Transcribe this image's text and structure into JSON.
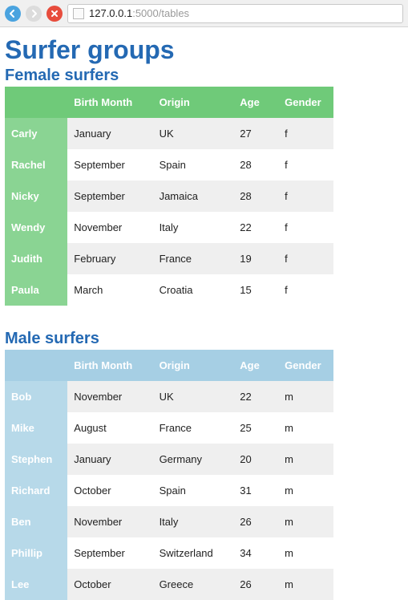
{
  "browser": {
    "url_host": "127.0.0.1",
    "url_path": ":5000/tables"
  },
  "page": {
    "title": "Surfer groups"
  },
  "sections": [
    {
      "heading": "Female surfers",
      "theme": "green",
      "columns": [
        "",
        "Birth Month",
        "Origin",
        "Age",
        "Gender"
      ],
      "rows": [
        {
          "name": "Carly",
          "birth_month": "January",
          "origin": "UK",
          "age": "27",
          "gender": "f"
        },
        {
          "name": "Rachel",
          "birth_month": "September",
          "origin": "Spain",
          "age": "28",
          "gender": "f"
        },
        {
          "name": "Nicky",
          "birth_month": "September",
          "origin": "Jamaica",
          "age": "28",
          "gender": "f"
        },
        {
          "name": "Wendy",
          "birth_month": "November",
          "origin": "Italy",
          "age": "22",
          "gender": "f"
        },
        {
          "name": "Judith",
          "birth_month": "February",
          "origin": "France",
          "age": "19",
          "gender": "f"
        },
        {
          "name": "Paula",
          "birth_month": "March",
          "origin": "Croatia",
          "age": "15",
          "gender": "f"
        }
      ]
    },
    {
      "heading": "Male surfers",
      "theme": "blue",
      "columns": [
        "",
        "Birth Month",
        "Origin",
        "Age",
        "Gender"
      ],
      "rows": [
        {
          "name": "Bob",
          "birth_month": "November",
          "origin": "UK",
          "age": "22",
          "gender": "m"
        },
        {
          "name": "Mike",
          "birth_month": "August",
          "origin": "France",
          "age": "25",
          "gender": "m"
        },
        {
          "name": "Stephen",
          "birth_month": "January",
          "origin": "Germany",
          "age": "20",
          "gender": "m"
        },
        {
          "name": "Richard",
          "birth_month": "October",
          "origin": "Spain",
          "age": "31",
          "gender": "m"
        },
        {
          "name": "Ben",
          "birth_month": "November",
          "origin": "Italy",
          "age": "26",
          "gender": "m"
        },
        {
          "name": "Phillip",
          "birth_month": "September",
          "origin": "Switzerland",
          "age": "34",
          "gender": "m"
        },
        {
          "name": "Lee",
          "birth_month": "October",
          "origin": "Greece",
          "age": "26",
          "gender": "m"
        }
      ]
    }
  ]
}
